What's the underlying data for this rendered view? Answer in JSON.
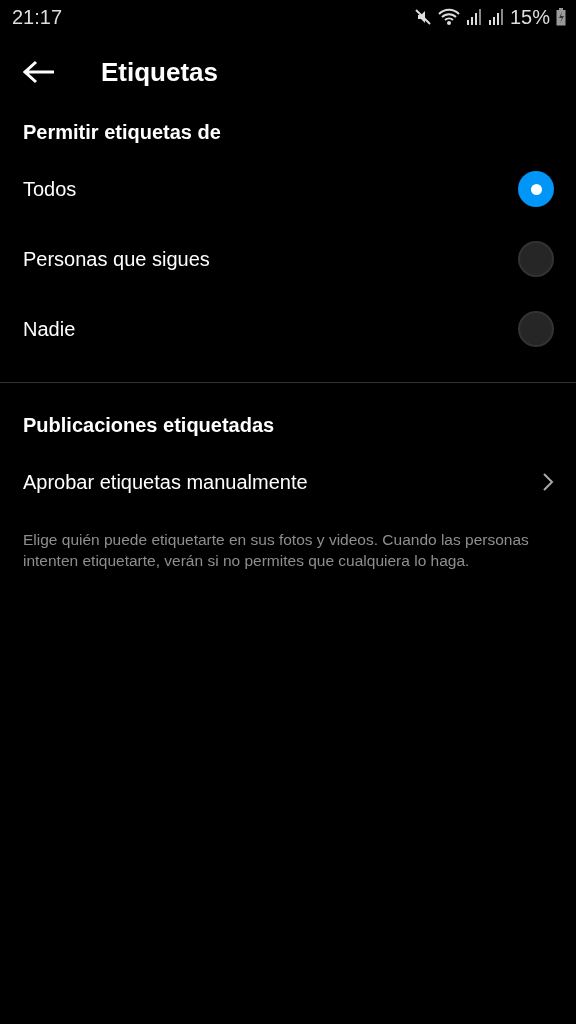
{
  "status_bar": {
    "time": "21:17",
    "battery": "15%"
  },
  "header": {
    "title": "Etiquetas"
  },
  "section_1": {
    "title": "Permitir etiquetas de",
    "options": [
      {
        "label": "Todos",
        "selected": true
      },
      {
        "label": "Personas que sigues",
        "selected": false
      },
      {
        "label": "Nadie",
        "selected": false
      }
    ]
  },
  "section_2": {
    "title": "Publicaciones etiquetadas",
    "items": [
      {
        "label": "Aprobar etiquetas manualmente"
      }
    ]
  },
  "footnote": "Elige quién puede etiquetarte en sus fotos y videos. Cuando las personas intenten etiquetarte, verán si no permites que cualquiera lo haga."
}
